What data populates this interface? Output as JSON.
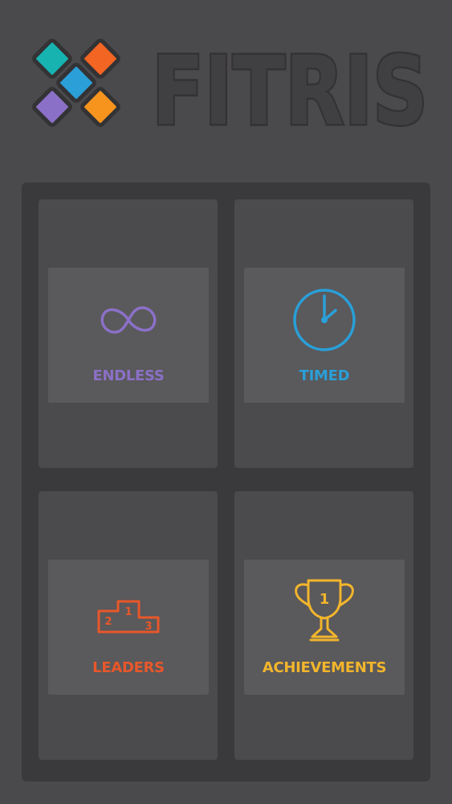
{
  "app": {
    "title": "FITRIS"
  },
  "colors": {
    "background": "#4a494b",
    "panel": "#3a393b",
    "tile": "#4b4a4c",
    "tile_inner": "#5a595b",
    "teal": "#17b3b1",
    "orange": "#f26522",
    "blue": "#2a9fd8",
    "purple": "#8b70c7",
    "amber": "#f7941d",
    "gold": "#f2b52c"
  },
  "menu": {
    "endless": {
      "label": "ENDLESS",
      "icon": "infinity-icon",
      "color": "#8b70c7"
    },
    "timed": {
      "label": "TIMED",
      "icon": "clock-icon",
      "color": "#2a9fd8"
    },
    "leaders": {
      "label": "LEADERS",
      "icon": "podium-icon",
      "color": "#e8572a",
      "places": [
        "1",
        "2",
        "3"
      ]
    },
    "achievements": {
      "label": "ACHIEVEMENTS",
      "icon": "trophy-icon",
      "color": "#f2b52c",
      "rank": "1"
    }
  }
}
